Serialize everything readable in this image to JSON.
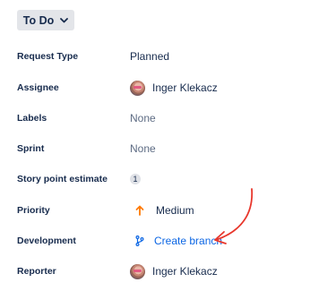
{
  "status": {
    "label": "To Do",
    "icon": "chevron-down-icon"
  },
  "fields": {
    "request_type": {
      "label": "Request Type",
      "value": "Planned"
    },
    "assignee": {
      "label": "Assignee",
      "value": "Inger Klekacz"
    },
    "labels": {
      "label": "Labels",
      "value": "None"
    },
    "sprint": {
      "label": "Sprint",
      "value": "None"
    },
    "story_points": {
      "label": "Story point estimate",
      "value": "1"
    },
    "priority": {
      "label": "Priority",
      "value": "Medium",
      "icon": "arrow-up-icon"
    },
    "development": {
      "label": "Development",
      "value": "Create branch",
      "icon": "branch-icon"
    },
    "reporter": {
      "label": "Reporter",
      "value": "Inger Klekacz"
    }
  },
  "colors": {
    "text": "#172B4D",
    "muted": "#5E6C84",
    "link": "#0C66E4",
    "priority": "#FF7A00",
    "annotation": "#E8372C",
    "button_bg": "#E3E5E9"
  }
}
